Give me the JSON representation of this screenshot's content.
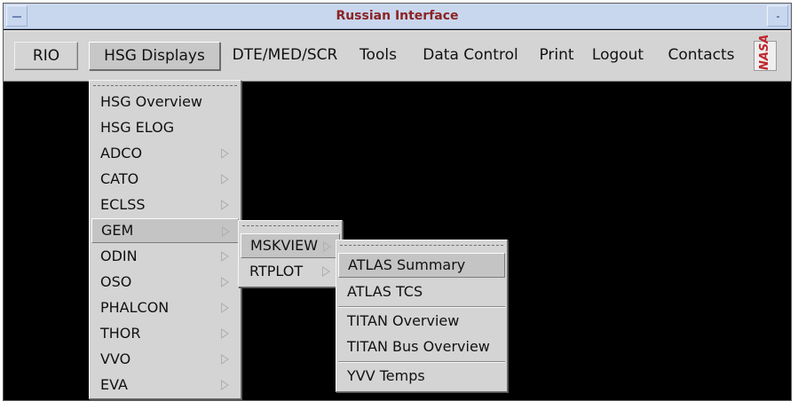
{
  "window": {
    "title": "Russian Interface"
  },
  "menubar": {
    "items": [
      {
        "label": "RIO"
      },
      {
        "label": "HSG Displays"
      },
      {
        "label": "DTE/MED/SCR"
      },
      {
        "label": "Tools"
      },
      {
        "label": "Data Control"
      },
      {
        "label": "Print"
      },
      {
        "label": "Logout"
      },
      {
        "label": "Contacts"
      }
    ],
    "logo": "NASA"
  },
  "hsg_menu": {
    "items": [
      {
        "label": "HSG Overview",
        "submenu": false
      },
      {
        "label": "HSG ELOG",
        "submenu": false
      },
      {
        "label": "ADCO",
        "submenu": true
      },
      {
        "label": "CATO",
        "submenu": true
      },
      {
        "label": "ECLSS",
        "submenu": true
      },
      {
        "label": "GEM",
        "submenu": true,
        "highlighted": true
      },
      {
        "label": "ODIN",
        "submenu": true
      },
      {
        "label": "OSO",
        "submenu": true
      },
      {
        "label": "PHALCON",
        "submenu": true
      },
      {
        "label": "THOR",
        "submenu": true
      },
      {
        "label": "VVO",
        "submenu": true
      },
      {
        "label": "EVA",
        "submenu": true
      }
    ]
  },
  "gem_menu": {
    "items": [
      {
        "label": "MSKVIEW",
        "submenu": true,
        "highlighted": true
      },
      {
        "label": "RTPLOT",
        "submenu": true
      }
    ]
  },
  "mskview_menu": {
    "items": [
      {
        "label": "ATLAS Summary",
        "highlighted": true
      },
      {
        "label": "ATLAS TCS"
      },
      {
        "label": "TITAN Overview"
      },
      {
        "label": "TITAN Bus Overview"
      },
      {
        "label": "YVV Temps"
      }
    ]
  },
  "colors": {
    "titlebar": "#c9d7ee",
    "title_text": "#8a2424",
    "menu_bg": "#d4d4d4",
    "workspace": "#000000",
    "logo_red": "#c0262b"
  }
}
